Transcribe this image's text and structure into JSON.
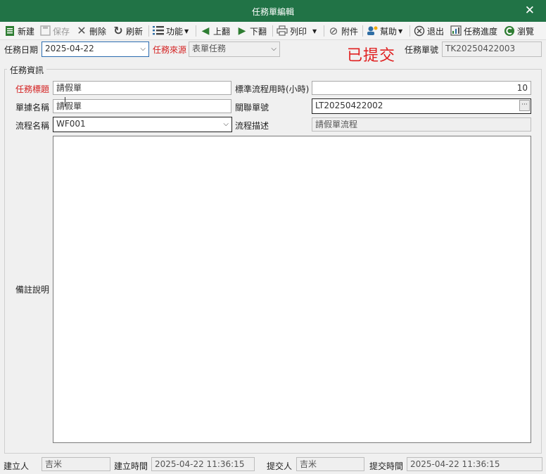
{
  "window": {
    "title": "任務單編輯",
    "close_glyph": "✕"
  },
  "toolbar": {
    "new": "新建",
    "save": "保存",
    "delete": "刪除",
    "refresh": "刷新",
    "functions": "功能",
    "prev": "上翻",
    "next": "下翻",
    "print": "列印",
    "attachment": "附件",
    "help": "幫助",
    "exit": "退出",
    "progress": "任務進度",
    "browse": "瀏覽"
  },
  "header": {
    "task_date_label": "任務日期",
    "task_date_value": "2025-04-22",
    "task_source_label": "任務來源",
    "task_source_value": "表單任務",
    "status_stamp": "已提交",
    "task_no_label": "任務單號",
    "task_no_value": "TK20250422003"
  },
  "task_info": {
    "group_title": "任務資訊",
    "title_label": "任務標題",
    "title_value": "請假單",
    "std_hours_label": "標準流程用時(小時)",
    "std_hours_value": "10",
    "doc_name_label": "單據名稱",
    "doc_name_value": "請假單",
    "related_no_label": "關聯單號",
    "related_no_value": "LT20250422002",
    "flow_name_label": "流程名稱",
    "flow_name_value": "WF001",
    "flow_desc_label": "流程描述",
    "flow_desc_value": "請假單流程",
    "remark_label": "備註說明",
    "remark_value": ""
  },
  "footer": {
    "creator_label": "建立人",
    "creator_value": "吉米",
    "created_time_label": "建立時間",
    "created_time_value": "2025-04-22 11:36:15",
    "submitter_label": "提交人",
    "submitter_value": "吉米",
    "submitted_time_label": "提交時間",
    "submitted_time_value": "2025-04-22 11:36:15"
  },
  "icons": {
    "new": "document-icon",
    "save": "floppy-icon",
    "delete": "x-icon",
    "refresh": "refresh-icon",
    "functions": "list-icon",
    "prev": "arrow-left-icon",
    "next": "arrow-right-icon",
    "print": "printer-icon",
    "attachment": "paperclip-icon",
    "help": "help-icon",
    "exit": "exit-circle-icon",
    "progress": "chart-icon",
    "browse": "browse-icon"
  },
  "colors": {
    "titlebar": "#217346",
    "required_label": "#d42020",
    "stamp": "#e02020"
  }
}
